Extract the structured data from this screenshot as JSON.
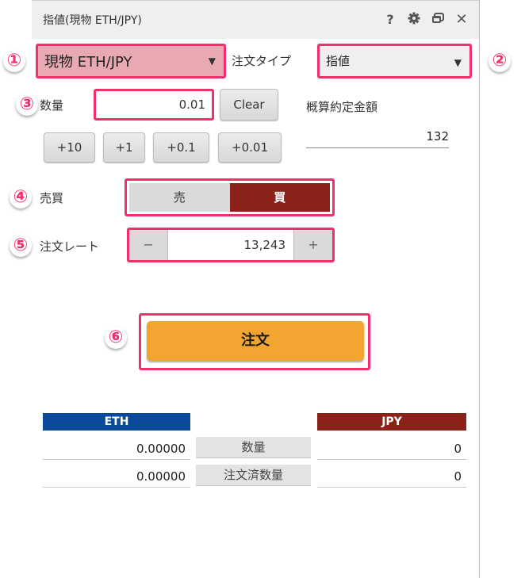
{
  "window": {
    "title": "指値(現物 ETH/JPY)",
    "icons": [
      {
        "name": "help-icon",
        "glyph": "?"
      },
      {
        "name": "gear-icon",
        "glyph": "✿"
      },
      {
        "name": "restore-window-icon",
        "glyph": "❐"
      },
      {
        "name": "close-icon",
        "glyph": "✕"
      }
    ]
  },
  "annotations": [
    "①",
    "②",
    "③",
    "④",
    "⑤",
    "⑥"
  ],
  "accent_color": "#f0306a",
  "symbol_select": {
    "value": "現物 ETH/JPY",
    "arrow": "▼"
  },
  "order_type": {
    "label": "注文タイプ",
    "value": "指値",
    "arrow": "▼"
  },
  "quantity": {
    "label": "数量",
    "value": "0.01",
    "clear_label": "Clear",
    "increments": [
      "+10",
      "+1",
      "+0.1",
      "+0.01"
    ]
  },
  "estimate": {
    "label": "概算約定金額",
    "value": "132"
  },
  "side": {
    "label": "売買",
    "sell": "売",
    "buy": "買",
    "selected": "buy",
    "buy_color": "#8b2219"
  },
  "rate": {
    "label": "注文レート",
    "minus": "−",
    "plus": "+",
    "value": "13,243"
  },
  "order_button": {
    "label": "注文",
    "color": "#f3a531"
  },
  "balance_table": {
    "left_header": "ETH",
    "right_header": "JPY",
    "left_color": "#0b4a9a",
    "right_color": "#8b2219",
    "rows": [
      {
        "left": "0.00000",
        "label": "数量",
        "right": "0"
      },
      {
        "left": "0.00000",
        "label": "注文済数量",
        "right": "0"
      }
    ]
  }
}
